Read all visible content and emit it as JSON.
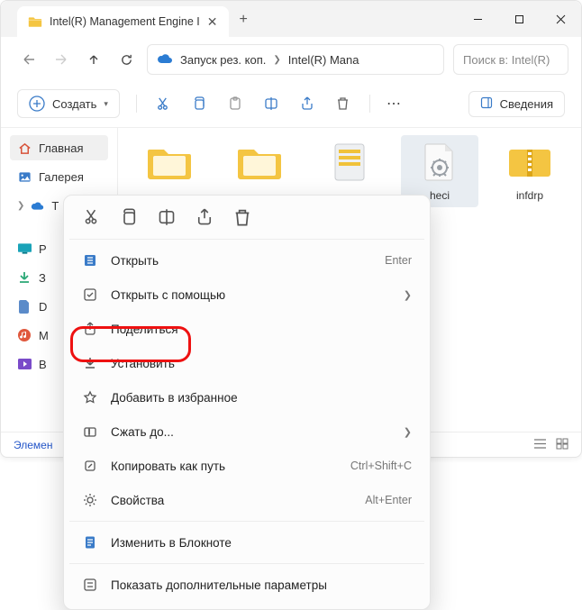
{
  "titlebar": {
    "tab_title": "Intel(R) Management Engine I",
    "newtab": "+"
  },
  "address": {
    "crumb1": "Запуск рез. коп.",
    "crumb2": "Intel(R) Mana",
    "search_placeholder": "Поиск в: Intel(R)"
  },
  "toolbar": {
    "create": "Создать",
    "details": "Сведения"
  },
  "sidebar": {
    "home": "Главная",
    "gallery": "Галерея",
    "cloud_short": "T",
    "p": "P",
    "dl_short": "З",
    "d": "D",
    "m": "M",
    "b": "B"
  },
  "files": {
    "item5": "heci",
    "item6": "infdrp"
  },
  "status": {
    "elements": "Элемен"
  },
  "ctx": {
    "open": "Открыть",
    "open_hint": "Enter",
    "open_with": "Открыть с помощью",
    "share": "Поделиться",
    "install": "Установить",
    "favorite": "Добавить в избранное",
    "compress": "Сжать до...",
    "copy_path": "Копировать как путь",
    "copy_path_hint": "Ctrl+Shift+C",
    "properties": "Свойства",
    "properties_hint": "Alt+Enter",
    "notepad": "Изменить в Блокноте",
    "more": "Показать дополнительные параметры"
  }
}
